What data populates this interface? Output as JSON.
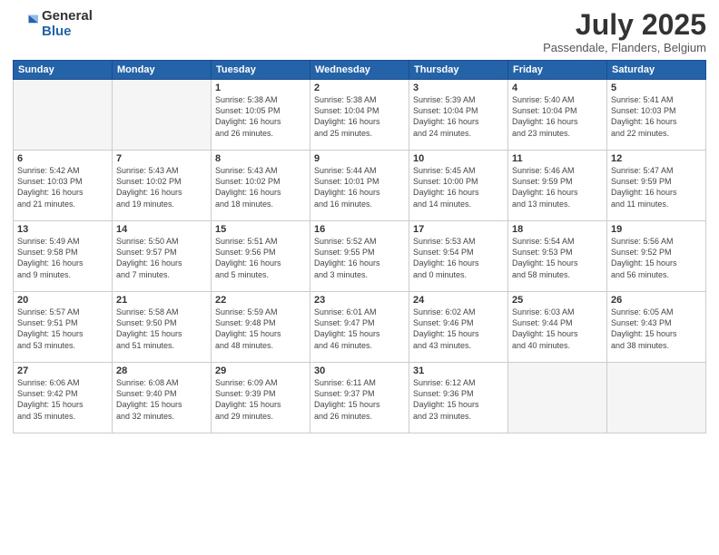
{
  "logo": {
    "general": "General",
    "blue": "Blue"
  },
  "header": {
    "month": "July 2025",
    "location": "Passendale, Flanders, Belgium"
  },
  "weekdays": [
    "Sunday",
    "Monday",
    "Tuesday",
    "Wednesday",
    "Thursday",
    "Friday",
    "Saturday"
  ],
  "weeks": [
    [
      {
        "day": "",
        "info": ""
      },
      {
        "day": "",
        "info": ""
      },
      {
        "day": "1",
        "info": "Sunrise: 5:38 AM\nSunset: 10:05 PM\nDaylight: 16 hours\nand 26 minutes."
      },
      {
        "day": "2",
        "info": "Sunrise: 5:38 AM\nSunset: 10:04 PM\nDaylight: 16 hours\nand 25 minutes."
      },
      {
        "day": "3",
        "info": "Sunrise: 5:39 AM\nSunset: 10:04 PM\nDaylight: 16 hours\nand 24 minutes."
      },
      {
        "day": "4",
        "info": "Sunrise: 5:40 AM\nSunset: 10:04 PM\nDaylight: 16 hours\nand 23 minutes."
      },
      {
        "day": "5",
        "info": "Sunrise: 5:41 AM\nSunset: 10:03 PM\nDaylight: 16 hours\nand 22 minutes."
      }
    ],
    [
      {
        "day": "6",
        "info": "Sunrise: 5:42 AM\nSunset: 10:03 PM\nDaylight: 16 hours\nand 21 minutes."
      },
      {
        "day": "7",
        "info": "Sunrise: 5:43 AM\nSunset: 10:02 PM\nDaylight: 16 hours\nand 19 minutes."
      },
      {
        "day": "8",
        "info": "Sunrise: 5:43 AM\nSunset: 10:02 PM\nDaylight: 16 hours\nand 18 minutes."
      },
      {
        "day": "9",
        "info": "Sunrise: 5:44 AM\nSunset: 10:01 PM\nDaylight: 16 hours\nand 16 minutes."
      },
      {
        "day": "10",
        "info": "Sunrise: 5:45 AM\nSunset: 10:00 PM\nDaylight: 16 hours\nand 14 minutes."
      },
      {
        "day": "11",
        "info": "Sunrise: 5:46 AM\nSunset: 9:59 PM\nDaylight: 16 hours\nand 13 minutes."
      },
      {
        "day": "12",
        "info": "Sunrise: 5:47 AM\nSunset: 9:59 PM\nDaylight: 16 hours\nand 11 minutes."
      }
    ],
    [
      {
        "day": "13",
        "info": "Sunrise: 5:49 AM\nSunset: 9:58 PM\nDaylight: 16 hours\nand 9 minutes."
      },
      {
        "day": "14",
        "info": "Sunrise: 5:50 AM\nSunset: 9:57 PM\nDaylight: 16 hours\nand 7 minutes."
      },
      {
        "day": "15",
        "info": "Sunrise: 5:51 AM\nSunset: 9:56 PM\nDaylight: 16 hours\nand 5 minutes."
      },
      {
        "day": "16",
        "info": "Sunrise: 5:52 AM\nSunset: 9:55 PM\nDaylight: 16 hours\nand 3 minutes."
      },
      {
        "day": "17",
        "info": "Sunrise: 5:53 AM\nSunset: 9:54 PM\nDaylight: 16 hours\nand 0 minutes."
      },
      {
        "day": "18",
        "info": "Sunrise: 5:54 AM\nSunset: 9:53 PM\nDaylight: 15 hours\nand 58 minutes."
      },
      {
        "day": "19",
        "info": "Sunrise: 5:56 AM\nSunset: 9:52 PM\nDaylight: 15 hours\nand 56 minutes."
      }
    ],
    [
      {
        "day": "20",
        "info": "Sunrise: 5:57 AM\nSunset: 9:51 PM\nDaylight: 15 hours\nand 53 minutes."
      },
      {
        "day": "21",
        "info": "Sunrise: 5:58 AM\nSunset: 9:50 PM\nDaylight: 15 hours\nand 51 minutes."
      },
      {
        "day": "22",
        "info": "Sunrise: 5:59 AM\nSunset: 9:48 PM\nDaylight: 15 hours\nand 48 minutes."
      },
      {
        "day": "23",
        "info": "Sunrise: 6:01 AM\nSunset: 9:47 PM\nDaylight: 15 hours\nand 46 minutes."
      },
      {
        "day": "24",
        "info": "Sunrise: 6:02 AM\nSunset: 9:46 PM\nDaylight: 15 hours\nand 43 minutes."
      },
      {
        "day": "25",
        "info": "Sunrise: 6:03 AM\nSunset: 9:44 PM\nDaylight: 15 hours\nand 40 minutes."
      },
      {
        "day": "26",
        "info": "Sunrise: 6:05 AM\nSunset: 9:43 PM\nDaylight: 15 hours\nand 38 minutes."
      }
    ],
    [
      {
        "day": "27",
        "info": "Sunrise: 6:06 AM\nSunset: 9:42 PM\nDaylight: 15 hours\nand 35 minutes."
      },
      {
        "day": "28",
        "info": "Sunrise: 6:08 AM\nSunset: 9:40 PM\nDaylight: 15 hours\nand 32 minutes."
      },
      {
        "day": "29",
        "info": "Sunrise: 6:09 AM\nSunset: 9:39 PM\nDaylight: 15 hours\nand 29 minutes."
      },
      {
        "day": "30",
        "info": "Sunrise: 6:11 AM\nSunset: 9:37 PM\nDaylight: 15 hours\nand 26 minutes."
      },
      {
        "day": "31",
        "info": "Sunrise: 6:12 AM\nSunset: 9:36 PM\nDaylight: 15 hours\nand 23 minutes."
      },
      {
        "day": "",
        "info": ""
      },
      {
        "day": "",
        "info": ""
      }
    ]
  ]
}
